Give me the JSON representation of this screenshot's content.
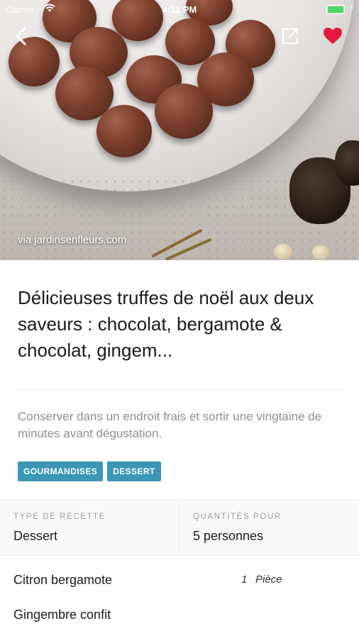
{
  "status_bar": {
    "carrier": "Carrier",
    "time": "4:11 PM"
  },
  "hero": {
    "credit": "via jardinsenfleurs.com"
  },
  "recipe": {
    "title": "Délicieuses truffes de noël aux deux saveurs : chocolat, bergamote & chocolat, gingem...",
    "description": "Conserver dans un endroit frais et sortir une vingtaine de minutes avant dégustation.",
    "tags": [
      "GOURMANDISES",
      "DESSERT"
    ],
    "type_label": "TYPE DE RECETTE",
    "type_value": "Dessert",
    "quantity_label": "QUANTITÉS POUR",
    "quantity_value": "5 personnes"
  },
  "ingredients": [
    {
      "name": "Citron bergamote",
      "qty": "1",
      "unit": "Pièce"
    },
    {
      "name": "Gingembre confit",
      "qty": "",
      "unit": ""
    }
  ],
  "colors": {
    "tag_bg": "#3b97b6",
    "heart": "#e5173f",
    "battery": "#4cd964"
  },
  "icons": {
    "back": "chevron-left-icon",
    "share": "share-icon",
    "favorite": "heart-icon"
  }
}
